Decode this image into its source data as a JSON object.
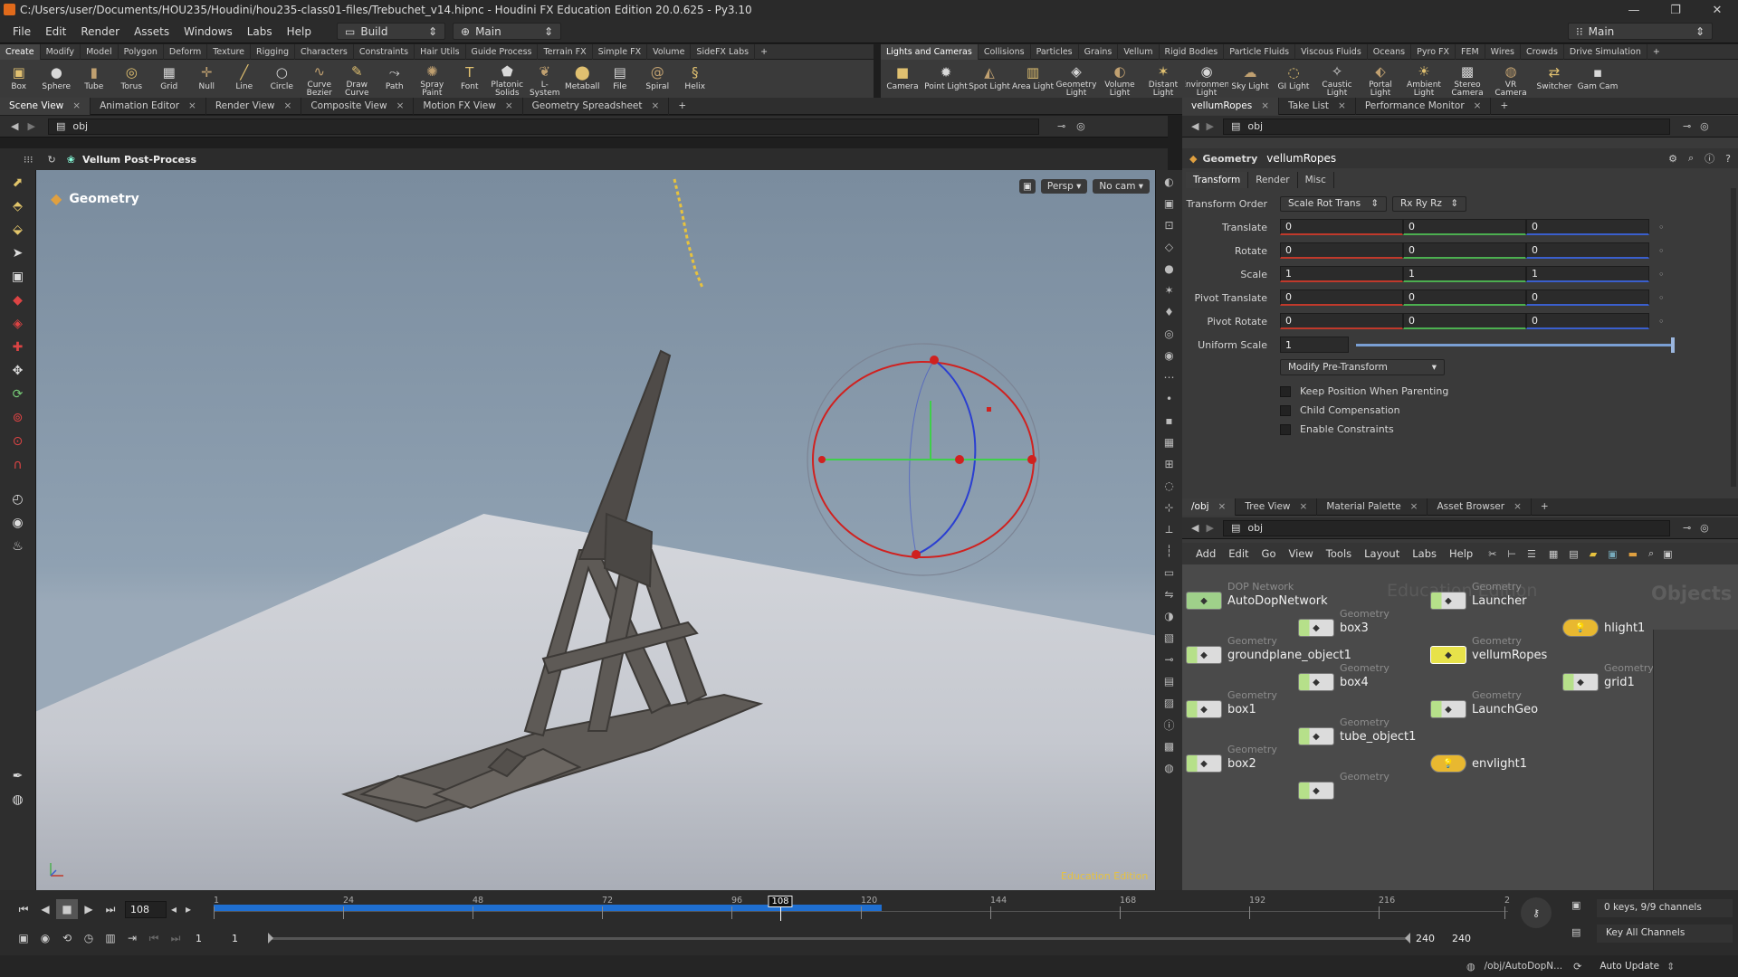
{
  "window": {
    "title": "C:/Users/user/Documents/HOU235/Houdini/hou235-class01-files/Trebuchet_v14.hipnc - Houdini FX Education Edition 20.0.625 - Py3.10",
    "minimize": "—",
    "maximize": "❐",
    "close": "✕"
  },
  "menubar": {
    "items": [
      "File",
      "Edit",
      "Render",
      "Assets",
      "Windows",
      "Labs",
      "Help"
    ],
    "desktop": "Build",
    "network": "Main",
    "right_desktop": "Main"
  },
  "shelf_left": {
    "tabs": [
      "Create",
      "Modify",
      "Model",
      "Polygon",
      "Deform",
      "Texture",
      "Rigging",
      "Characters",
      "Constraints",
      "Hair Utils",
      "Guide Process",
      "Terrain FX",
      "Simple FX",
      "Volume",
      "SideFX Labs"
    ],
    "tools": [
      {
        "label": "Box",
        "icon": "box-icon",
        "glyph": "▣"
      },
      {
        "label": "Sphere",
        "icon": "sphere-icon",
        "glyph": "●"
      },
      {
        "label": "Tube",
        "icon": "tube-icon",
        "glyph": "▮"
      },
      {
        "label": "Torus",
        "icon": "torus-icon",
        "glyph": "◎"
      },
      {
        "label": "Grid",
        "icon": "grid-icon",
        "glyph": "▦"
      },
      {
        "label": "Null",
        "icon": "null-icon",
        "glyph": "✛"
      },
      {
        "label": "Line",
        "icon": "line-icon",
        "glyph": "╱"
      },
      {
        "label": "Circle",
        "icon": "circle-icon",
        "glyph": "○"
      },
      {
        "label": "Curve Bezier",
        "icon": "curve-bezier-icon",
        "glyph": "∿"
      },
      {
        "label": "Draw Curve",
        "icon": "draw-curve-icon",
        "glyph": "✎"
      },
      {
        "label": "Path",
        "icon": "path-icon",
        "glyph": "⤳"
      },
      {
        "label": "Spray Paint",
        "icon": "spray-paint-icon",
        "glyph": "✺"
      },
      {
        "label": "Font",
        "icon": "font-icon",
        "glyph": "T"
      },
      {
        "label": "Platonic Solids",
        "icon": "platonic-solids-icon",
        "glyph": "⬟"
      },
      {
        "label": "L-System",
        "icon": "l-system-icon",
        "glyph": "❦"
      },
      {
        "label": "Metaball",
        "icon": "metaball-icon",
        "glyph": "⬤"
      },
      {
        "label": "File",
        "icon": "file-icon",
        "glyph": "▤"
      },
      {
        "label": "Spiral",
        "icon": "spiral-icon",
        "glyph": "@"
      },
      {
        "label": "Helix",
        "icon": "helix-icon",
        "glyph": "§"
      }
    ]
  },
  "shelf_right": {
    "tabs": [
      "Lights and Cameras",
      "Collisions",
      "Particles",
      "Grains",
      "Vellum",
      "Rigid Bodies",
      "Particle Fluids",
      "Viscous Fluids",
      "Oceans",
      "Pyro FX",
      "FEM",
      "Wires",
      "Crowds",
      "Drive Simulation"
    ],
    "tools": [
      {
        "label": "Camera",
        "icon": "camera-icon",
        "glyph": "■"
      },
      {
        "label": "Point Light",
        "icon": "point-light-icon",
        "glyph": "✹"
      },
      {
        "label": "Spot Light",
        "icon": "spot-light-icon",
        "glyph": "◭"
      },
      {
        "label": "Area Light",
        "icon": "area-light-icon",
        "glyph": "▥"
      },
      {
        "label": "Geometry Light",
        "icon": "geometry-light-icon",
        "glyph": "◈"
      },
      {
        "label": "Volume Light",
        "icon": "volume-light-icon",
        "glyph": "◐"
      },
      {
        "label": "Distant Light",
        "icon": "distant-light-icon",
        "glyph": "✶"
      },
      {
        "label": "Environment Light",
        "icon": "environment-light-icon",
        "glyph": "◉"
      },
      {
        "label": "Sky Light",
        "icon": "sky-light-icon",
        "glyph": "☁"
      },
      {
        "label": "GI Light",
        "icon": "gi-light-icon",
        "glyph": "◌"
      },
      {
        "label": "Caustic Light",
        "icon": "caustic-light-icon",
        "glyph": "✧"
      },
      {
        "label": "Portal Light",
        "icon": "portal-light-icon",
        "glyph": "⬖"
      },
      {
        "label": "Ambient Light",
        "icon": "ambient-light-icon",
        "glyph": "☀"
      },
      {
        "label": "Stereo Camera",
        "icon": "stereo-camera-icon",
        "glyph": "▩"
      },
      {
        "label": "VR Camera",
        "icon": "vr-camera-icon",
        "glyph": "◍"
      },
      {
        "label": "Switcher",
        "icon": "switcher-icon",
        "glyph": "⇄"
      },
      {
        "label": "Gam Cam",
        "icon": "gamepad-camera-icon",
        "glyph": "▪"
      }
    ]
  },
  "view_tabs": [
    "Scene View",
    "Animation Editor",
    "Render View",
    "Composite View",
    "Motion FX View",
    "Geometry Spreadsheet"
  ],
  "viewer": {
    "path": "obj",
    "header_label": "Vellum Post-Process",
    "context": "Geometry",
    "persp": "Persp ▾",
    "cam": "No cam ▾",
    "watermark": "Education Edition"
  },
  "right_tabs": [
    "vellumRopes",
    "Take List",
    "Performance Monitor"
  ],
  "params": {
    "path": "obj",
    "node_type": "Geometry",
    "node_name": "vellumRopes",
    "tabs": [
      "Transform",
      "Render",
      "Misc"
    ],
    "transform_order_label": "Transform Order",
    "transform_order": "Scale Rot Trans",
    "rot_order": "Rx Ry Rz",
    "rows": [
      {
        "label": "Translate",
        "v": [
          "0",
          "0",
          "0"
        ]
      },
      {
        "label": "Rotate",
        "v": [
          "0",
          "0",
          "0"
        ]
      },
      {
        "label": "Scale",
        "v": [
          "1",
          "1",
          "1"
        ]
      },
      {
        "label": "Pivot Translate",
        "v": [
          "0",
          "0",
          "0"
        ]
      },
      {
        "label": "Pivot Rotate",
        "v": [
          "0",
          "0",
          "0"
        ]
      }
    ],
    "uniform_scale_label": "Uniform Scale",
    "uniform_scale": "1",
    "pre_transform": "Modify Pre-Transform",
    "checks": [
      "Keep Position When Parenting",
      "Child Compensation",
      "Enable Constraints"
    ]
  },
  "net_tabs": [
    "/obj",
    "Tree View",
    "Material Palette",
    "Asset Browser"
  ],
  "network": {
    "path": "obj",
    "menu": [
      "Add",
      "Edit",
      "Go",
      "View",
      "Tools",
      "Layout",
      "Labs",
      "Help"
    ],
    "edition": "Education Edition",
    "context": "Objects",
    "nodes": [
      {
        "type": "DOP Network",
        "name": "AutoDopNetwork"
      },
      {
        "type": "Geometry",
        "name": "Launcher"
      },
      {
        "type": "Geometry",
        "name": "box3"
      },
      {
        "type": "",
        "name": "hlight1"
      },
      {
        "type": "Geometry",
        "name": "groundplane_object1"
      },
      {
        "type": "Geometry",
        "name": "vellumRopes"
      },
      {
        "type": "Geometry",
        "name": "box4"
      },
      {
        "type": "Geometry",
        "name": "grid1"
      },
      {
        "type": "Geometry",
        "name": "box1"
      },
      {
        "type": "Geometry",
        "name": "LaunchGeo"
      },
      {
        "type": "Geometry",
        "name": "tube_object1"
      },
      {
        "type": "Geometry",
        "name": "box2"
      },
      {
        "type": "",
        "name": "envlight1"
      },
      {
        "type": "Geometry",
        "name": ""
      }
    ]
  },
  "timeline": {
    "frame": "108",
    "start": "1",
    "start2": "1",
    "end": "240",
    "end2": "240",
    "ticks": [
      "1",
      "24",
      "48",
      "72",
      "96",
      "120",
      "144",
      "168",
      "192",
      "216",
      "2"
    ],
    "keys": "0 keys, 9/9 channels",
    "key_all": "Key All Channels",
    "status_path": "/obj/AutoDopN...",
    "auto_update": "Auto Update"
  },
  "colors": {
    "accent": "#e7c23e",
    "x_axis": "#c0392b",
    "y_axis": "#4caf50",
    "z_axis": "#3a5fcd",
    "timeline_range": "#1f6fd1"
  }
}
